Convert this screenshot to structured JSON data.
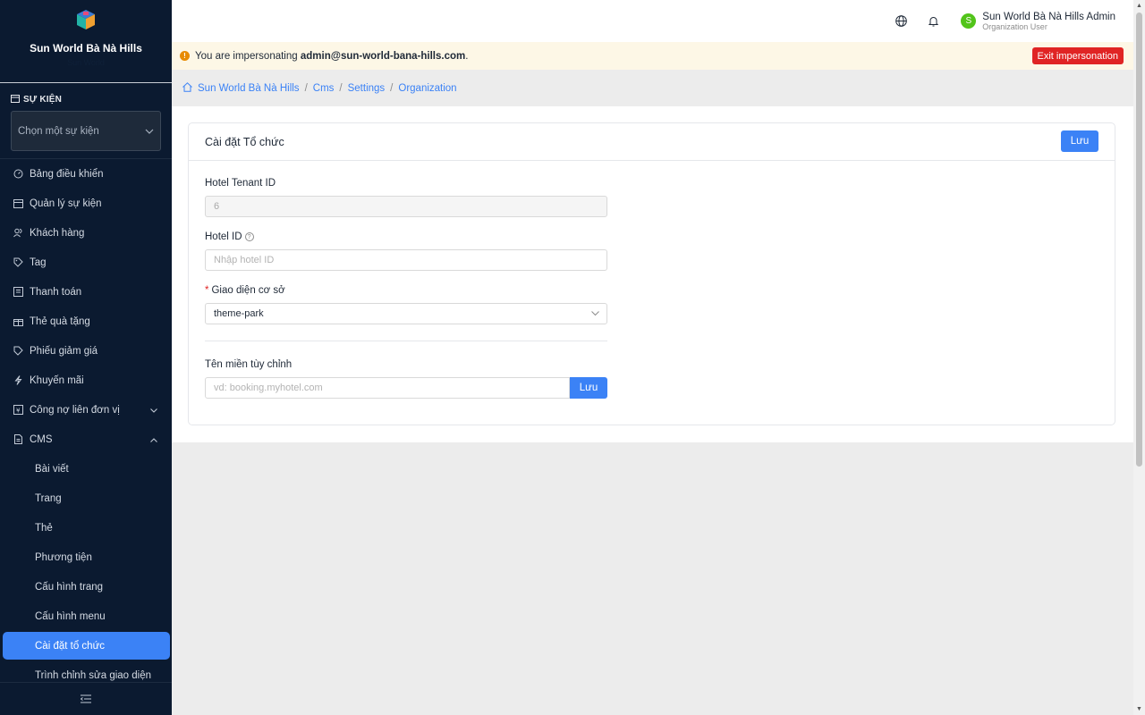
{
  "sidebar": {
    "brand_name": "Sun World Bà Nà Hills",
    "brand_sub": "Sun World",
    "event_section_label": "SỰ KIỆN",
    "event_select_placeholder": "Chọn một sự kiện",
    "items": [
      {
        "label": "Bảng điều khiển",
        "icon": "dashboard-icon"
      },
      {
        "label": "Quản lý sự kiện",
        "icon": "calendar-icon"
      },
      {
        "label": "Khách hàng",
        "icon": "users-icon"
      },
      {
        "label": "Tag",
        "icon": "tag-icon"
      },
      {
        "label": "Thanh toán",
        "icon": "payment-icon"
      },
      {
        "label": "Thẻ quà tặng",
        "icon": "gift-icon"
      },
      {
        "label": "Phiếu giảm giá",
        "icon": "coupon-icon"
      },
      {
        "label": "Khuyến mãi",
        "icon": "promo-icon"
      },
      {
        "label": "Công nợ liên đơn vị",
        "icon": "debt-icon"
      },
      {
        "label": "CMS",
        "icon": "cms-icon"
      }
    ],
    "cms_items": [
      {
        "label": "Bài viết"
      },
      {
        "label": "Trang"
      },
      {
        "label": "Thẻ"
      },
      {
        "label": "Phương tiện"
      },
      {
        "label": "Cấu hình trang"
      },
      {
        "label": "Cấu hình menu"
      },
      {
        "label": "Cài đặt tổ chức"
      },
      {
        "label": "Trình chỉnh sửa giao diện"
      }
    ]
  },
  "header": {
    "user_initial": "S",
    "user_name": "Sun World Bà Nà Hills Admin",
    "user_role": "Organization User"
  },
  "banner": {
    "prefix": "You are impersonating ",
    "email": "admin@sun-world-bana-hills.com",
    "suffix": ".",
    "exit_label": "Exit impersonation"
  },
  "breadcrumb": [
    "Sun World Bà Nà Hills",
    "Cms",
    "Settings",
    "Organization"
  ],
  "card": {
    "title": "Cài đặt Tổ chức",
    "save_label": "Lưu",
    "tenant_label": "Hotel Tenant ID",
    "tenant_value": "6",
    "hotel_id_label": "Hotel ID",
    "hotel_id_placeholder": "Nhập hotel ID",
    "theme_label": "Giao diện cơ sở",
    "theme_value": "theme-park",
    "domain_label": "Tên miền tùy chỉnh",
    "domain_placeholder": "vd: booking.myhotel.com",
    "domain_save_label": "Lưu"
  },
  "colors": {
    "sidebar_bg": "#0b1a30",
    "accent": "#3b82f6",
    "danger": "#e02424",
    "avatar": "#52c41a"
  }
}
